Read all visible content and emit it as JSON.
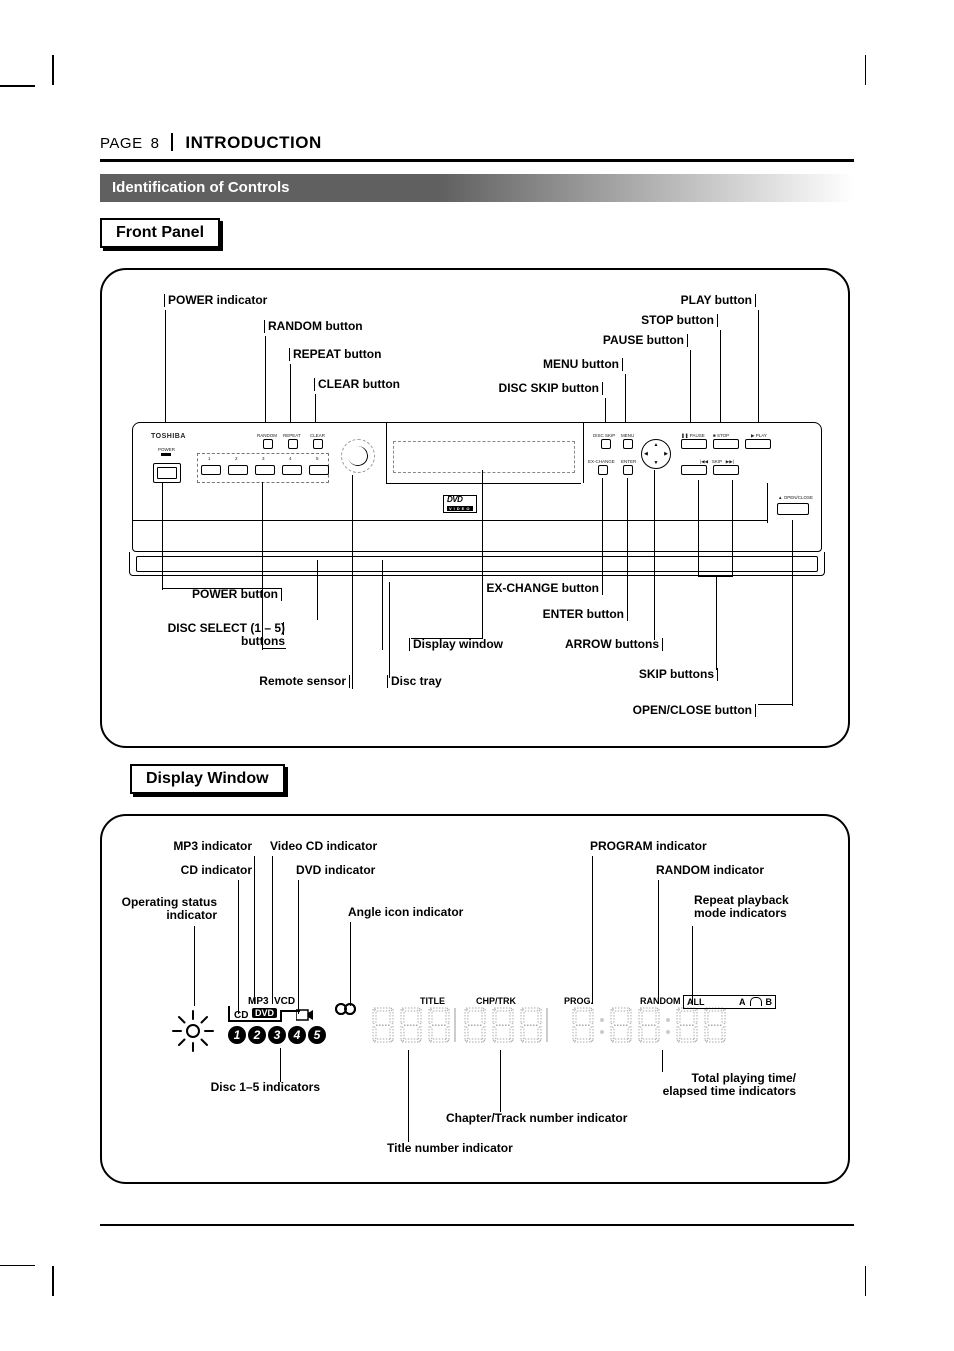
{
  "header": {
    "page_label": "PAGE",
    "page_number": "8",
    "section_name": "INTRODUCTION"
  },
  "section_title": "Identification of Controls",
  "front_panel": {
    "heading": "Front Panel",
    "labels_top_left": {
      "power_ind": "POWER indicator",
      "random_btn": "RANDOM button",
      "repeat_btn": "REPEAT button",
      "clear_btn": "CLEAR button"
    },
    "labels_top_right": {
      "play_btn": "PLAY button",
      "stop_btn": "STOP button",
      "pause_btn": "PAUSE button",
      "menu_btn": "MENU button",
      "disc_skip_btn": "DISC SKIP button"
    },
    "labels_bottom_left": {
      "power_btn": "POWER button",
      "disc_select": "DISC SELECT (1 – 5)\nbuttons",
      "remote_sensor": "Remote sensor"
    },
    "labels_bottom_mid": {
      "disc_tray": "Disc tray",
      "display_window": "Display window"
    },
    "labels_bottom_right": {
      "exchange_btn": "EX-CHANGE button",
      "enter_btn": "ENTER button",
      "arrow_btns": "ARROW buttons",
      "skip_btns": "SKIP buttons",
      "open_close_btn": "OPEN/CLOSE button"
    },
    "device": {
      "brand": "TOSHIBA",
      "power": "POWER",
      "random": "RANDOM",
      "repeat": "REPEAT",
      "clear": "CLEAR",
      "discskip": "DISC SKIP",
      "menu": "MENU",
      "pause": "PAUSE",
      "stop": "STOP",
      "play": "PLAY",
      "exchange": "EX-CHANGE",
      "enter": "ENTER",
      "skip": "SKIP",
      "openclose": "OPEN/CLOSE",
      "disc_numbers": [
        "1",
        "2",
        "3",
        "4",
        "5"
      ],
      "dvd_logo_top": "DVD",
      "dvd_logo_bottom": "VIDEO"
    }
  },
  "display_window": {
    "heading": "Display Window",
    "labels_top_left": {
      "mp3_ind": "MP3 indicator",
      "cd_ind": "CD indicator",
      "operating_status": "Operating status\nindicator",
      "vcd_ind": "Video CD indicator",
      "dvd_ind": "DVD indicator",
      "angle_ind": "Angle icon indicator"
    },
    "labels_top_right": {
      "program_ind": "PROGRAM indicator",
      "random_ind": "RANDOM indicator",
      "repeat_ind": "Repeat playback\nmode indicators"
    },
    "labels_bottom": {
      "disc15": "Disc 1–5 indicators",
      "title_num": "Title number indicator",
      "chp_trk": "Chapter/Track number indicator",
      "total_time": "Total playing time/\nelapsed time indicators"
    },
    "lcd": {
      "mp3": "MP3",
      "vcd": "VCD",
      "cd": "CD",
      "dvd": "DVD",
      "disc_numbers": [
        "1",
        "2",
        "3",
        "4",
        "5"
      ],
      "title": "TITLE",
      "chptrk": "CHP/TRK",
      "prog": "PROG.",
      "random": "RANDOM",
      "all": "ALL",
      "repeat_chapter": "A",
      "repeat_track": "B"
    }
  }
}
